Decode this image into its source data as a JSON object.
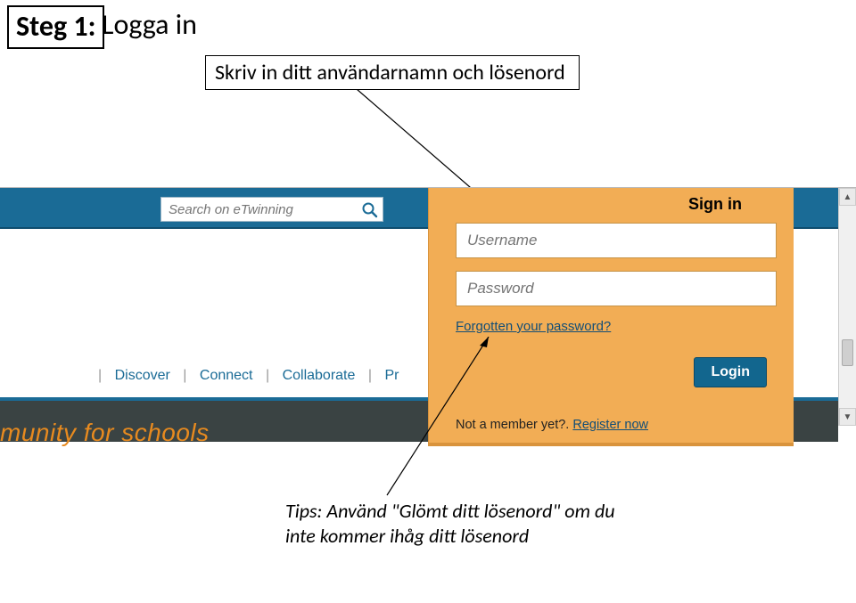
{
  "step": {
    "label": "Steg 1:",
    "title": "Logga in"
  },
  "callout_top": "Skriv in ditt användarnamn och lösenord",
  "search": {
    "placeholder": "Search on eTwinning"
  },
  "nav": {
    "items": [
      "Discover",
      "Connect",
      "Collaborate",
      "Pr"
    ]
  },
  "signin": {
    "title": "Sign in",
    "username_placeholder": "Username",
    "password_placeholder": "Password",
    "forgot": "Forgotten your password?",
    "login": "Login",
    "not_member": "Not a member yet?. ",
    "register": "Register now"
  },
  "hero_text": "munity for schools",
  "callout_bottom": "Tips: Använd \"Glömt ditt lösenord\" om du inte kommer ihåg ditt lösenord"
}
